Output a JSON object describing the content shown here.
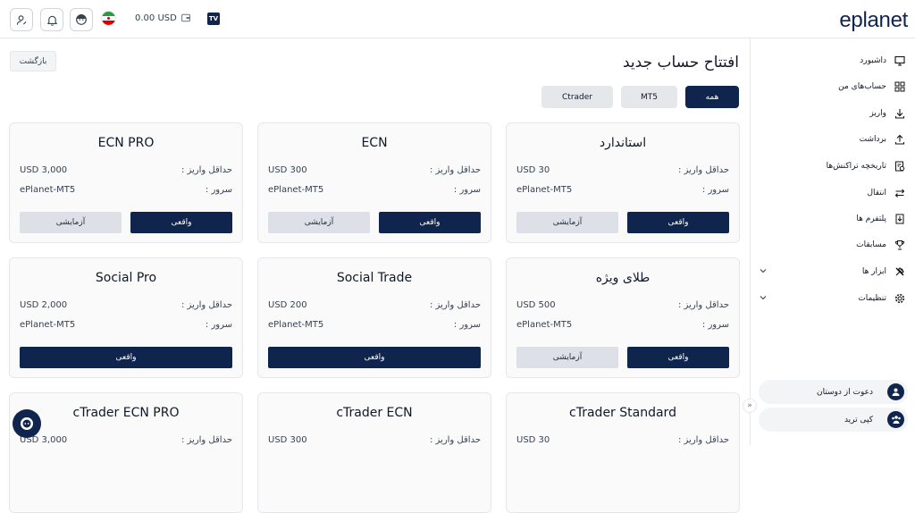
{
  "topbar": {
    "balance": "0.00 USD",
    "tv_label": "TV",
    "logo": "eplanet"
  },
  "sidebar": {
    "items": [
      {
        "label": "داشبورد",
        "icon": "monitor-icon"
      },
      {
        "label": "حساب‌های من",
        "icon": "grid-icon"
      },
      {
        "label": "واریز",
        "icon": "download-icon"
      },
      {
        "label": "برداشت",
        "icon": "upload-icon"
      },
      {
        "label": "تاریخچه تراکنش‌ها",
        "icon": "history-icon"
      },
      {
        "label": "انتقال",
        "icon": "transfer-icon"
      },
      {
        "label": "پلتفرم ها",
        "icon": "platform-icon"
      },
      {
        "label": "مسابقات",
        "icon": "trophy-icon"
      },
      {
        "label": "ابزار ها",
        "icon": "tools-icon"
      },
      {
        "label": "تنظیمات",
        "icon": "gear-icon"
      }
    ],
    "invite": "دعوت از دوستان",
    "copy_trade": "کپی ترید"
  },
  "page": {
    "title": "افتتاح حساب جدید",
    "back": "بازگشت",
    "filters": [
      "همه",
      "MT5",
      "Ctrader"
    ]
  },
  "labels": {
    "min_deposit": "حداقل واریز :",
    "server": "سرور :",
    "real": "واقعی",
    "demo": "آزمایشی"
  },
  "cards": [
    {
      "title": "استاندارد",
      "min": "USD 30",
      "server": "ePlanet-MT5"
    },
    {
      "title": "ECN",
      "min": "USD 300",
      "server": "ePlanet-MT5"
    },
    {
      "title": "ECN PRO",
      "min": "USD 3,000",
      "server": "ePlanet-MT5"
    },
    {
      "title": "طلای ویژه",
      "min": "USD 500",
      "server": "ePlanet-MT5"
    },
    {
      "title": "Social Trade",
      "min": "USD 200",
      "server": "ePlanet-MT5"
    },
    {
      "title": "Social Pro",
      "min": "USD 2,000",
      "server": "ePlanet-MT5"
    },
    {
      "title": "cTrader Standard",
      "min": "USD 30"
    },
    {
      "title": "cTrader ECN",
      "min": "USD 300"
    },
    {
      "title": "cTrader ECN PRO",
      "min": "USD 3,000"
    }
  ],
  "colors": {
    "primary": "#10254d",
    "demo_button": "#dde1e7"
  }
}
